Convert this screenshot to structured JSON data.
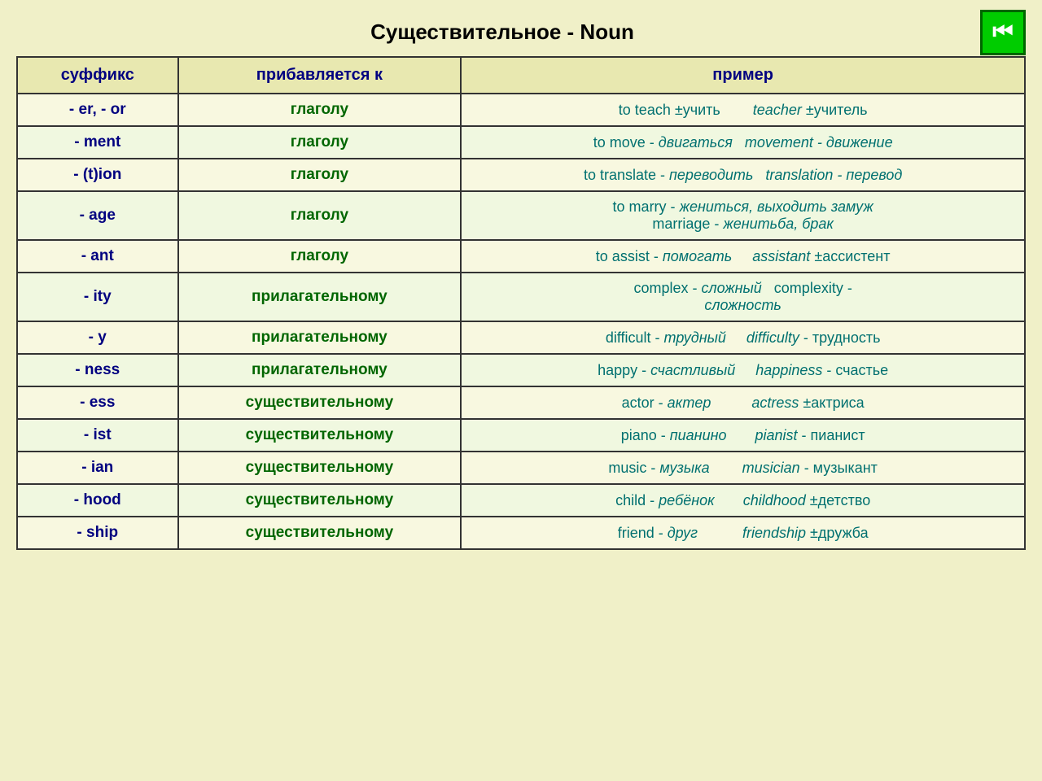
{
  "title": "Существительное - Noun",
  "nav_button": {
    "icon": "⏮",
    "label": "back"
  },
  "table": {
    "headers": [
      "суффикс",
      "прибавляется к",
      "пример"
    ],
    "rows": [
      {
        "suffix": "- er, - or",
        "added_to": "глаголу",
        "example_html": "to teach ±учить &nbsp;&nbsp;&nbsp;&nbsp;&nbsp;&nbsp; <i>teacher</i> ±учитель"
      },
      {
        "suffix": "- ment",
        "added_to": "глаголу",
        "example_html": "to move - <i>двигаться &nbsp; movement - движение</i>"
      },
      {
        "suffix": "- (t)ion",
        "added_to": "глаголу",
        "example_html": "to translate - <i>переводить &nbsp; translation - перевод</i>"
      },
      {
        "suffix": "- age",
        "added_to": "глаголу",
        "example_html": "to marry - <i>жениться, выходить замуж</i><br>marriage - <i>женитьба, брак</i>"
      },
      {
        "suffix": "- ant",
        "added_to": "глаголу",
        "example_html": "to assist - <i>помогать</i> &nbsp;&nbsp;&nbsp; <i>assistant</i> ±ассистент"
      },
      {
        "suffix": "- ity",
        "added_to": "прилагательному",
        "example_html": "complex - <i>сложный</i> &nbsp; complexity -<br><i>сложность</i>"
      },
      {
        "suffix": "- y",
        "added_to": "прилагательному",
        "example_html": "difficult - <i>трудный</i> &nbsp;&nbsp;&nbsp; <i>difficulty</i> - трудность"
      },
      {
        "suffix": "- ness",
        "added_to": "прилагательному",
        "example_html": "happy - <i>счастливый</i> &nbsp;&nbsp;&nbsp; <i>happiness</i> - счастье"
      },
      {
        "suffix": "- ess",
        "added_to": "существительному",
        "example_html": "actor - <i>актер</i> &nbsp;&nbsp;&nbsp;&nbsp;&nbsp;&nbsp;&nbsp;&nbsp; <i>actress</i> ±актриса"
      },
      {
        "suffix": "- ist",
        "added_to": "существительному",
        "example_html": "piano - <i>пианино</i> &nbsp;&nbsp;&nbsp;&nbsp;&nbsp; <i>pianist</i> - пианист"
      },
      {
        "suffix": "- ian",
        "added_to": "существительному",
        "example_html": "music - <i>музыка</i> &nbsp;&nbsp;&nbsp;&nbsp;&nbsp;&nbsp; <i>musician</i> - музыкант"
      },
      {
        "suffix": "- hood",
        "added_to": "существительному",
        "example_html": "child - <i>ребёнок</i> &nbsp;&nbsp;&nbsp;&nbsp;&nbsp; <i>childhood</i> ±детство"
      },
      {
        "suffix": "- ship",
        "added_to": "существительному",
        "example_html": "friend - <i>друг</i> &nbsp;&nbsp;&nbsp;&nbsp;&nbsp;&nbsp;&nbsp;&nbsp;&nbsp; <i>friendship</i> ±дружба"
      }
    ]
  }
}
